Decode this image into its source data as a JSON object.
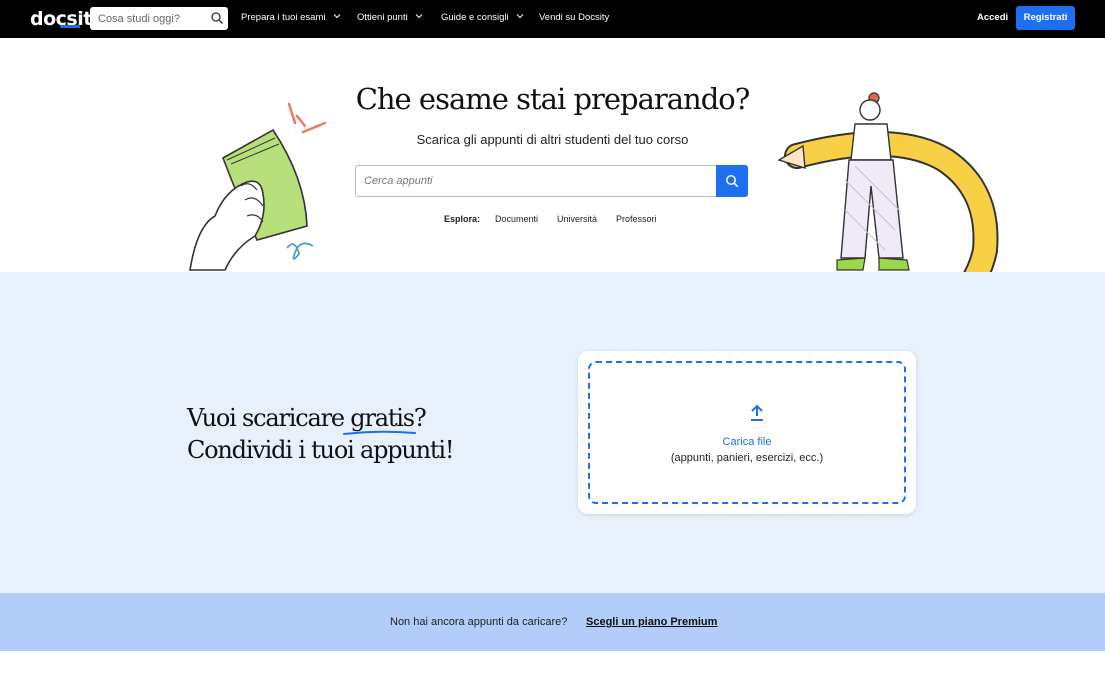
{
  "header": {
    "logo": "docsity",
    "search_placeholder": "Cosa studi oggi?",
    "nav": [
      {
        "label": "Prepara i tuoi esami"
      },
      {
        "label": "Ottieni punti"
      },
      {
        "label": "Guide e consigli"
      },
      {
        "label": "Vendi su Docsity"
      }
    ],
    "login_label": "Accedi",
    "register_label": "Registrati"
  },
  "hero": {
    "title": "Che esame stai preparando?",
    "subtitle": "Scarica gli appunti di altri studenti del tuo corso",
    "search_placeholder": "Cerca appunti",
    "explore_label": "Esplora:",
    "explore_links": [
      "Documenti",
      "Università",
      "Professori"
    ]
  },
  "upload_section": {
    "headline_line1": "Vuoi scaricare gratis?",
    "headline_line2": "Condividi i tuoi appunti!",
    "upload_label": "Carica file",
    "upload_hint": "(appunti, panieri, esercizi, ecc.)"
  },
  "premium": {
    "text": "Non hai ancora appunti da caricare?",
    "link": "Scegli un piano Premium"
  },
  "colors": {
    "brand_blue": "#1d6ff0",
    "band_bg": "#e8f0fc",
    "premium_bg": "#b3cdfa",
    "pencil_yellow": "#f7d046"
  }
}
